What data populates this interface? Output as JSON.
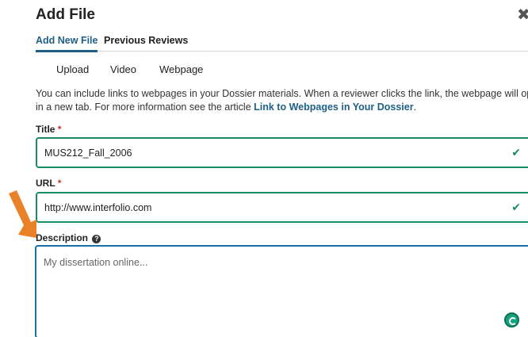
{
  "dialog": {
    "title": "Add File",
    "close_icon": "close-icon"
  },
  "tabs": [
    {
      "label": "Add New File",
      "active": true
    },
    {
      "label": "Previous Reviews",
      "active": false
    }
  ],
  "subtabs": [
    {
      "label": "Upload"
    },
    {
      "label": "Video"
    },
    {
      "label": "Webpage"
    }
  ],
  "intro": {
    "line1": "You can include links to webpages in your Dossier materials. When a reviewer clicks the link, the webpage will open",
    "line2_prefix": "in a new tab. For more information see the article ",
    "link": "Link to Webpages in Your Dossier",
    "line2_suffix": "."
  },
  "fields": {
    "title": {
      "label": "Title",
      "required_mark": "*",
      "value": "MUS212_Fall_2006",
      "status_icon": "check-icon"
    },
    "url": {
      "label": "URL",
      "required_mark": "*",
      "value": "http://www.interfolio.com",
      "status_icon": "check-icon"
    },
    "description": {
      "label": "Description",
      "help_icon": "question-circle-icon",
      "placeholder": "My dissertation online..."
    }
  },
  "colors": {
    "accent": "#1f5f86",
    "valid_border": "#1b8a6b",
    "focus_border": "#1a6fa0",
    "arrow": "#e8812a"
  }
}
